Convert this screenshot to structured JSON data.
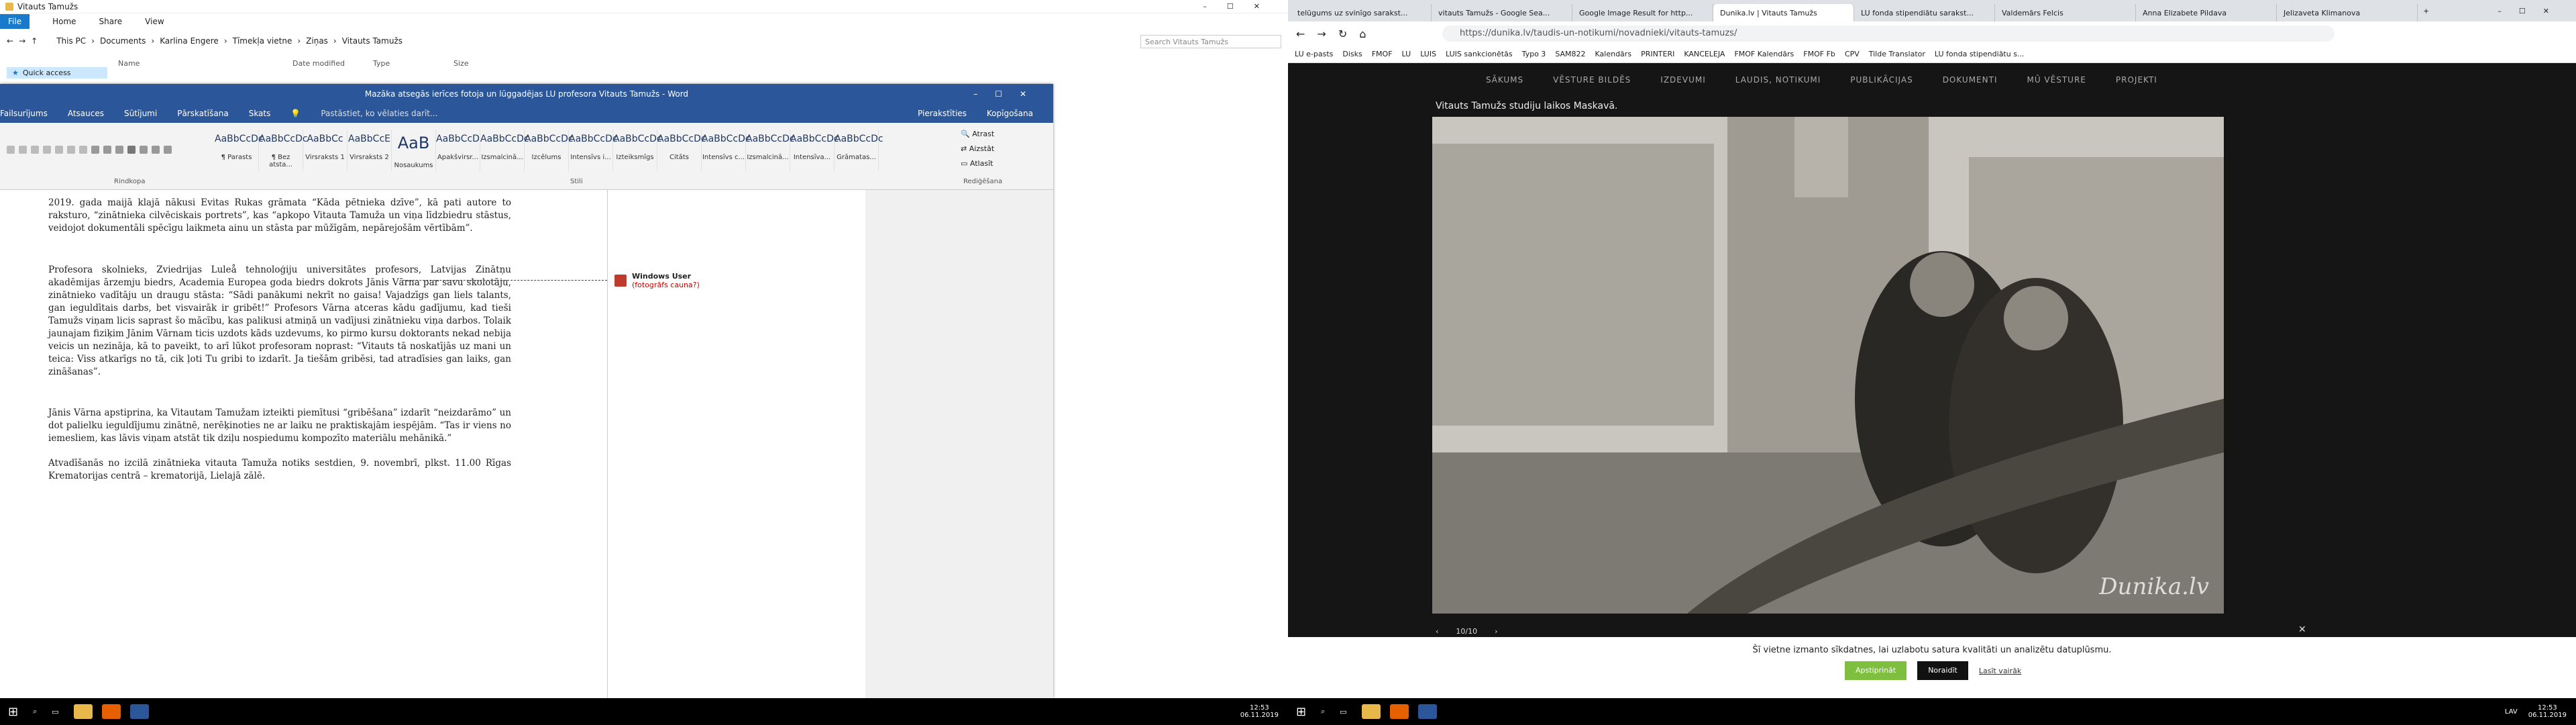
{
  "explorer": {
    "title": "Vitauts Tamužs",
    "ribbon_tabs": [
      "File",
      "Home",
      "Share",
      "View"
    ],
    "breadcrumb": [
      "This PC",
      "Documents",
      "Karlina Engere",
      "Tīmekļa vietne",
      "Ziņas",
      "Vitauts Tamužs"
    ],
    "search_placeholder": "Search Vitauts Tamužs",
    "columns": [
      "Name",
      "Date modified",
      "Type",
      "Size"
    ],
    "quick_access": "Quick access"
  },
  "word": {
    "title": "Mazāka atsegās ierīces fotoja un lūggadējas LU profesora Vitauts Tamužs - Word",
    "search_hint": "Pastāstiet, ko vēlaties darīt...",
    "tabs": [
      "Failsurījums",
      "Atsauces",
      "Sūtījumi",
      "Pārskatīšana",
      "Skats"
    ],
    "right_tabs": [
      "Pierakstīties",
      "Kopīgošana"
    ],
    "groups": [
      "Rindkopa",
      "Stili",
      "Rediģēšana"
    ],
    "styles": [
      {
        "sample": "AaBbCcDc",
        "name": "¶ Parasts"
      },
      {
        "sample": "AaBbCcDc",
        "name": "¶ Bez atsta..."
      },
      {
        "sample": "AaBbCc",
        "name": "Virsraksts 1"
      },
      {
        "sample": "AaBbCcE",
        "name": "Virsraksts 2"
      },
      {
        "sample": "AaB",
        "name": "Nosaukums"
      },
      {
        "sample": "AaBbCcD",
        "name": "Apakšvirsr..."
      },
      {
        "sample": "AaBbCcDc",
        "name": "Izsmalcinā..."
      },
      {
        "sample": "AaBbCcDc",
        "name": "Izcēlums"
      },
      {
        "sample": "AaBbCcDc",
        "name": "Intensīvs i..."
      },
      {
        "sample": "AaBbCcDc",
        "name": "Izteiksmīgs"
      },
      {
        "sample": "AaBbCcDc",
        "name": "Citāts"
      },
      {
        "sample": "AaBbCcDc",
        "name": "Intensīvs c..."
      },
      {
        "sample": "AaBbCcDc",
        "name": "Izsmalcinā..."
      },
      {
        "sample": "AaBbCcDc",
        "name": "Intensīva..."
      },
      {
        "sample": "AaBbCcDc",
        "name": "Grāmatas..."
      }
    ],
    "editing": [
      "Atrast",
      "Aizstāt",
      "Atlasīt"
    ],
    "paragraphs": [
      "2019. gada maijā klajā nākusi Evitas Rukas grāmata “Kāda pētnieka dzīve”, kā pati autore to raksturo, “zinātnieka cilvēciskais portrets”, kas “apkopo Vitauta Tamuža un viņa līdzbiedru stāstus, veidojot dokumentāli spēcīgu laikmeta ainu un stāsta par mūžīgām, nepārejošām vērtībām”.",
      "Profesora skolnieks, Zviedrijas Luleå tehnoloģiju universitātes profesors, Latvijas Zinātņu akadēmijas ārzemju biedrs, Academia Europea goda biedrs dokrots Jānis Vārna par savu skolotāju, zinātnieko vadītāju un draugu stāsta: “Sādi panākumi nekrīt no gaisa! Vajadzīgs gan liels talants, gan ieguldītais darbs, bet visvairāk ir gribēt!” Profesors Vārna atceras kādu gadījumu, kad tieši Tamužs viņam licis saprast šo mācību, kas palikusi atmiņā un vadījusi zinātnieku viņa darbos. Tolaik jaunajam fiziķim Jānim Vārnam ticis uzdots kāds uzdevums, ko pirmo kursu doktorants nekad nebija veicis un nezināja, kā to paveikt, to arī lūkot profesoram noprast: “Vitauts tā noskatījās uz mani un teica: Viss atkarīgs no tā, cik ļoti Tu gribi to izdarīt. Ja tiešām gribēsi, tad atradīsies gan laiks, gan zināšanas”.",
      "Jānis Vārna apstiprina, ka Vitautam Tamužam izteikti piemītusi “gribēšana” izdarīt “neizdarāmo” un dot palielku ieguldījumu zinātnē, nerēķinoties ne ar laiku ne praktiskajām iespējām. “Tas ir viens no iemesliem, kas lāvis viņam atstāt tik dziļu nospiedumu kompozīto materiālu mehānikā.”",
      "Atvadīšanās no izcilā zinātnieka vitauta Tamuža notiks sestdien, 9. novembrī, plkst. 11.00 Rīgas Krematorijas centrā – krematorijā, Lielajā zālē."
    ],
    "comment": {
      "author": "Windows User",
      "text": "(fotogrāfs cauna?)"
    }
  },
  "browser": {
    "tabs": [
      "telūgums uz svinīgo sarakst...",
      "vitauts Tamužs - Google Sea...",
      "Google Image Result for http...",
      "Dunika.lv | Vitauts Tamužs",
      "LU fonda stipendiātu sarakst...",
      "Valdemārs Felcis",
      "Anna Elizabete Pildava",
      "Jelizaveta Klimanova"
    ],
    "url": "https://dunika.lv/taudis-un-notikumi/novadnieki/vitauts-tamuzs/",
    "bookmarks": [
      "LU e-pasts",
      "Disks",
      "FMOF",
      "LU",
      "LUIS",
      "LUIS sankcionētās",
      "Typo 3",
      "SAM822",
      "Kalendārs",
      "PRINTERI",
      "KANCELEJA",
      "FMOF Kalendārs",
      "FMOF Fb",
      "CPV",
      "Tilde Translator",
      "LU fonda stipendiātu s..."
    ],
    "site_nav": [
      "SĀKUMS",
      "VĒSTURE BILDĒS",
      "IZDEVUMI",
      "LAUDIS, NOTIKUMI",
      "PUBLIKĀCIJAS",
      "DOKUMENTI",
      "MŪ VĒSTURE",
      "PROJEKTI"
    ],
    "caption": "Vitauts Tamužs studiju laikos Maskavā.",
    "watermark": "Dunika.lv",
    "counter": "10/10",
    "cookie_text": "Šī vietne izmanto sīkdatnes, lai uzlabotu satura kvalitāti un analizētu datuplūsmu.",
    "accept": "Apstiprināt",
    "reject": "Noraidīt",
    "more": "Lasīt vairāk"
  },
  "taskbar": {
    "left_time": "12:53",
    "left_date": "06.11.2019",
    "right_time": "12:53",
    "right_date": "06.11.2019",
    "lang": "LAV"
  },
  "colors": {
    "word_blue": "#2b579a",
    "site_dark": "#151515",
    "accept_green": "#7fbf3f"
  }
}
